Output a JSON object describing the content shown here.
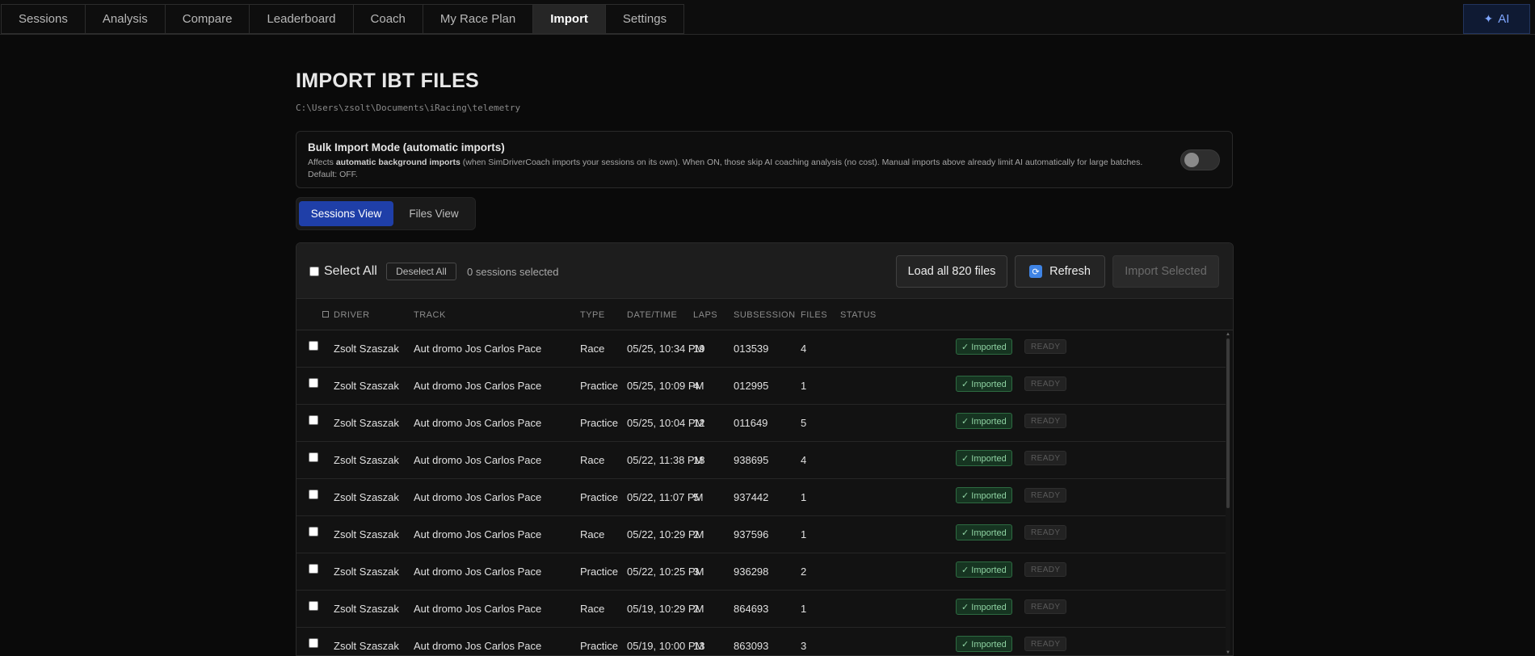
{
  "nav": {
    "tabs": [
      {
        "label": "Sessions"
      },
      {
        "label": "Analysis"
      },
      {
        "label": "Compare"
      },
      {
        "label": "Leaderboard"
      },
      {
        "label": "Coach"
      },
      {
        "label": "My Race Plan"
      },
      {
        "label": "Import"
      },
      {
        "label": "Settings"
      }
    ],
    "active_tab": "Import",
    "ai_label": "AI"
  },
  "page": {
    "title": "IMPORT IBT FILES",
    "path": "C:\\Users\\zsolt\\Documents\\iRacing\\telemetry"
  },
  "bulk": {
    "title": "Bulk Import Mode (automatic imports)",
    "desc_prefix": "Affects ",
    "desc_bold": "automatic background imports",
    "desc_suffix": " (when SimDriverCoach imports your sessions on its own). When ON, those skip AI coaching analysis (no cost). Manual imports above already limit AI automatically for large batches. Default: OFF.",
    "toggle_on": false
  },
  "views": {
    "sessions": "Sessions View",
    "files": "Files View",
    "active": "sessions"
  },
  "toolbar": {
    "select_all": "Select All",
    "deselect_all": "Deselect All",
    "selected_count": "0 sessions selected",
    "load_all": "Load all 820 files",
    "refresh": "Refresh",
    "import_selected": "Import Selected"
  },
  "table": {
    "headers": {
      "driver": "DRIVER",
      "track": "TRACK",
      "type": "TYPE",
      "datetime": "DATE/TIME",
      "laps": "LAPS",
      "subsession": "SUBSESSION",
      "files": "FILES",
      "status": "STATUS"
    },
    "rows": [
      {
        "driver": "Zsolt Szaszak",
        "track": "Aut dromo Jos Carlos Pace",
        "type": "Race",
        "datetime": "05/25, 10:34 PM",
        "laps": "19",
        "subsession": "013539",
        "files": "4",
        "status": "✓ Imported",
        "state": "READY"
      },
      {
        "driver": "Zsolt Szaszak",
        "track": "Aut dromo Jos Carlos Pace",
        "type": "Practice",
        "datetime": "05/25, 10:09 PM",
        "laps": "4",
        "subsession": "012995",
        "files": "1",
        "status": "✓ Imported",
        "state": "READY"
      },
      {
        "driver": "Zsolt Szaszak",
        "track": "Aut dromo Jos Carlos Pace",
        "type": "Practice",
        "datetime": "05/25, 10:04 PM",
        "laps": "12",
        "subsession": "011649",
        "files": "5",
        "status": "✓ Imported",
        "state": "READY"
      },
      {
        "driver": "Zsolt Szaszak",
        "track": "Aut dromo Jos Carlos Pace",
        "type": "Race",
        "datetime": "05/22, 11:38 PM",
        "laps": "18",
        "subsession": "938695",
        "files": "4",
        "status": "✓ Imported",
        "state": "READY"
      },
      {
        "driver": "Zsolt Szaszak",
        "track": "Aut dromo Jos Carlos Pace",
        "type": "Practice",
        "datetime": "05/22, 11:07 PM",
        "laps": "5",
        "subsession": "937442",
        "files": "1",
        "status": "✓ Imported",
        "state": "READY"
      },
      {
        "driver": "Zsolt Szaszak",
        "track": "Aut dromo Jos Carlos Pace",
        "type": "Race",
        "datetime": "05/22, 10:29 PM",
        "laps": "2",
        "subsession": "937596",
        "files": "1",
        "status": "✓ Imported",
        "state": "READY"
      },
      {
        "driver": "Zsolt Szaszak",
        "track": "Aut dromo Jos Carlos Pace",
        "type": "Practice",
        "datetime": "05/22, 10:25 PM",
        "laps": "3",
        "subsession": "936298",
        "files": "2",
        "status": "✓ Imported",
        "state": "READY"
      },
      {
        "driver": "Zsolt Szaszak",
        "track": "Aut dromo Jos Carlos Pace",
        "type": "Race",
        "datetime": "05/19, 10:29 PM",
        "laps": "2",
        "subsession": "864693",
        "files": "1",
        "status": "✓ Imported",
        "state": "READY"
      },
      {
        "driver": "Zsolt Szaszak",
        "track": "Aut dromo Jos Carlos Pace",
        "type": "Practice",
        "datetime": "05/19, 10:00 PM",
        "laps": "13",
        "subsession": "863093",
        "files": "3",
        "status": "✓ Imported",
        "state": "READY"
      }
    ]
  },
  "colors": {
    "accent": "#1f3fa8",
    "imported_bg": "#163421",
    "imported_text": "#8fd3a3",
    "ai": "#7fa6ff"
  }
}
